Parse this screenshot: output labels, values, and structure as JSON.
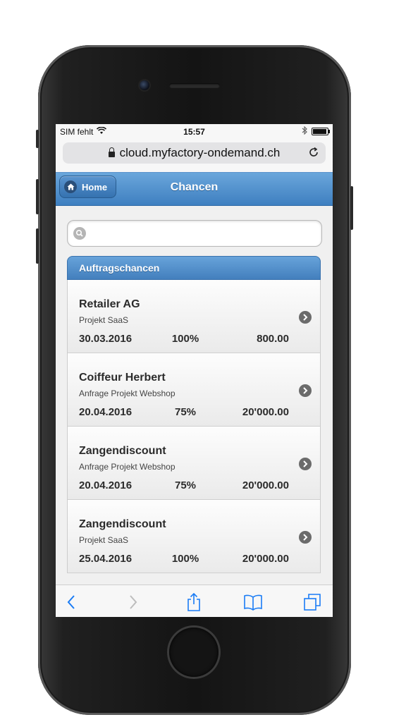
{
  "status_bar": {
    "carrier": "SIM fehlt",
    "time": "15:57",
    "battery_level": 0.85
  },
  "browser": {
    "url": "cloud.myfactory-ondemand.ch"
  },
  "header": {
    "home_label": "Home",
    "title": "Chancen"
  },
  "search": {
    "placeholder": "",
    "value": ""
  },
  "list": {
    "heading": "Auftragschancen",
    "items": [
      {
        "name": "Retailer AG",
        "subtitle": "Projekt SaaS",
        "date": "30.03.2016",
        "percent": "100%",
        "amount": "800.00"
      },
      {
        "name": "Coiffeur Herbert",
        "subtitle": "Anfrage Projekt Webshop",
        "date": "20.04.2016",
        "percent": "75%",
        "amount": "20'000.00"
      },
      {
        "name": "Zangendiscount",
        "subtitle": "Anfrage Projekt Webshop",
        "date": "20.04.2016",
        "percent": "75%",
        "amount": "20'000.00"
      },
      {
        "name": "Zangendiscount",
        "subtitle": "Projekt SaaS",
        "date": "25.04.2016",
        "percent": "100%",
        "amount": "20'000.00"
      }
    ]
  },
  "colors": {
    "accent": "#4a8ac9",
    "ios_tint": "#1a7cf5"
  },
  "icons": {
    "wifi": "wifi-icon",
    "bluetooth": "bluetooth-icon",
    "battery": "battery-icon",
    "lock": "lock-icon",
    "reload": "reload-icon",
    "home": "home-icon",
    "search": "search-icon",
    "arrow": "chevron-right-circle-icon",
    "back": "back-icon",
    "forward": "forward-icon",
    "share": "share-icon",
    "bookmarks": "bookmarks-icon",
    "tabs": "tabs-icon"
  }
}
